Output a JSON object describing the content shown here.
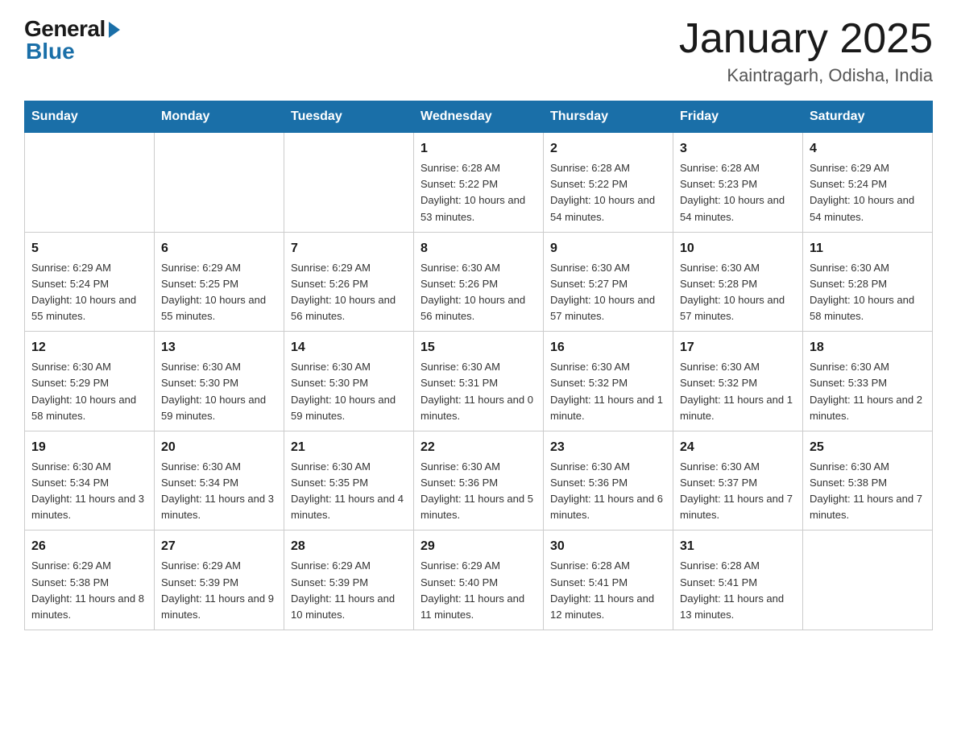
{
  "header": {
    "logo_general": "General",
    "logo_blue": "Blue",
    "month_title": "January 2025",
    "location": "Kaintragarh, Odisha, India"
  },
  "days_of_week": [
    "Sunday",
    "Monday",
    "Tuesday",
    "Wednesday",
    "Thursday",
    "Friday",
    "Saturday"
  ],
  "weeks": [
    [
      {
        "day": "",
        "info": ""
      },
      {
        "day": "",
        "info": ""
      },
      {
        "day": "",
        "info": ""
      },
      {
        "day": "1",
        "info": "Sunrise: 6:28 AM\nSunset: 5:22 PM\nDaylight: 10 hours and 53 minutes."
      },
      {
        "day": "2",
        "info": "Sunrise: 6:28 AM\nSunset: 5:22 PM\nDaylight: 10 hours and 54 minutes."
      },
      {
        "day": "3",
        "info": "Sunrise: 6:28 AM\nSunset: 5:23 PM\nDaylight: 10 hours and 54 minutes."
      },
      {
        "day": "4",
        "info": "Sunrise: 6:29 AM\nSunset: 5:24 PM\nDaylight: 10 hours and 54 minutes."
      }
    ],
    [
      {
        "day": "5",
        "info": "Sunrise: 6:29 AM\nSunset: 5:24 PM\nDaylight: 10 hours and 55 minutes."
      },
      {
        "day": "6",
        "info": "Sunrise: 6:29 AM\nSunset: 5:25 PM\nDaylight: 10 hours and 55 minutes."
      },
      {
        "day": "7",
        "info": "Sunrise: 6:29 AM\nSunset: 5:26 PM\nDaylight: 10 hours and 56 minutes."
      },
      {
        "day": "8",
        "info": "Sunrise: 6:30 AM\nSunset: 5:26 PM\nDaylight: 10 hours and 56 minutes."
      },
      {
        "day": "9",
        "info": "Sunrise: 6:30 AM\nSunset: 5:27 PM\nDaylight: 10 hours and 57 minutes."
      },
      {
        "day": "10",
        "info": "Sunrise: 6:30 AM\nSunset: 5:28 PM\nDaylight: 10 hours and 57 minutes."
      },
      {
        "day": "11",
        "info": "Sunrise: 6:30 AM\nSunset: 5:28 PM\nDaylight: 10 hours and 58 minutes."
      }
    ],
    [
      {
        "day": "12",
        "info": "Sunrise: 6:30 AM\nSunset: 5:29 PM\nDaylight: 10 hours and 58 minutes."
      },
      {
        "day": "13",
        "info": "Sunrise: 6:30 AM\nSunset: 5:30 PM\nDaylight: 10 hours and 59 minutes."
      },
      {
        "day": "14",
        "info": "Sunrise: 6:30 AM\nSunset: 5:30 PM\nDaylight: 10 hours and 59 minutes."
      },
      {
        "day": "15",
        "info": "Sunrise: 6:30 AM\nSunset: 5:31 PM\nDaylight: 11 hours and 0 minutes."
      },
      {
        "day": "16",
        "info": "Sunrise: 6:30 AM\nSunset: 5:32 PM\nDaylight: 11 hours and 1 minute."
      },
      {
        "day": "17",
        "info": "Sunrise: 6:30 AM\nSunset: 5:32 PM\nDaylight: 11 hours and 1 minute."
      },
      {
        "day": "18",
        "info": "Sunrise: 6:30 AM\nSunset: 5:33 PM\nDaylight: 11 hours and 2 minutes."
      }
    ],
    [
      {
        "day": "19",
        "info": "Sunrise: 6:30 AM\nSunset: 5:34 PM\nDaylight: 11 hours and 3 minutes."
      },
      {
        "day": "20",
        "info": "Sunrise: 6:30 AM\nSunset: 5:34 PM\nDaylight: 11 hours and 3 minutes."
      },
      {
        "day": "21",
        "info": "Sunrise: 6:30 AM\nSunset: 5:35 PM\nDaylight: 11 hours and 4 minutes."
      },
      {
        "day": "22",
        "info": "Sunrise: 6:30 AM\nSunset: 5:36 PM\nDaylight: 11 hours and 5 minutes."
      },
      {
        "day": "23",
        "info": "Sunrise: 6:30 AM\nSunset: 5:36 PM\nDaylight: 11 hours and 6 minutes."
      },
      {
        "day": "24",
        "info": "Sunrise: 6:30 AM\nSunset: 5:37 PM\nDaylight: 11 hours and 7 minutes."
      },
      {
        "day": "25",
        "info": "Sunrise: 6:30 AM\nSunset: 5:38 PM\nDaylight: 11 hours and 7 minutes."
      }
    ],
    [
      {
        "day": "26",
        "info": "Sunrise: 6:29 AM\nSunset: 5:38 PM\nDaylight: 11 hours and 8 minutes."
      },
      {
        "day": "27",
        "info": "Sunrise: 6:29 AM\nSunset: 5:39 PM\nDaylight: 11 hours and 9 minutes."
      },
      {
        "day": "28",
        "info": "Sunrise: 6:29 AM\nSunset: 5:39 PM\nDaylight: 11 hours and 10 minutes."
      },
      {
        "day": "29",
        "info": "Sunrise: 6:29 AM\nSunset: 5:40 PM\nDaylight: 11 hours and 11 minutes."
      },
      {
        "day": "30",
        "info": "Sunrise: 6:28 AM\nSunset: 5:41 PM\nDaylight: 11 hours and 12 minutes."
      },
      {
        "day": "31",
        "info": "Sunrise: 6:28 AM\nSunset: 5:41 PM\nDaylight: 11 hours and 13 minutes."
      },
      {
        "day": "",
        "info": ""
      }
    ]
  ]
}
